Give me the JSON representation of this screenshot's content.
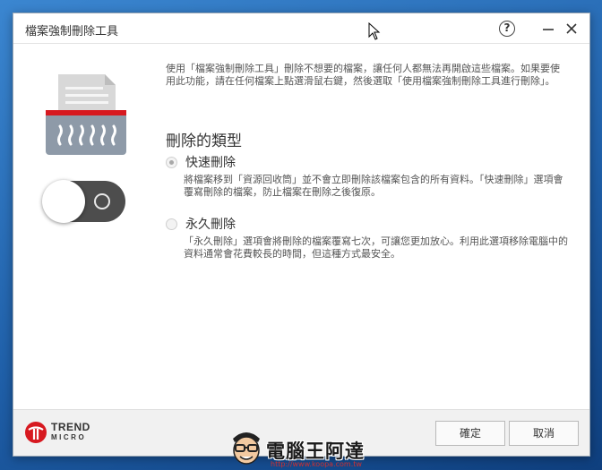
{
  "window": {
    "title": "檔案強制刪除工具",
    "help_glyph": "?",
    "minimize_glyph": "—",
    "close_glyph": "✕"
  },
  "content": {
    "intro": "使用「檔案強制刪除工具」刪除不想要的檔案，讓任何人都無法再開啟這些檔案。如果要使用此功能，請在任何檔案上點選滑鼠右鍵，然後選取「使用檔案強制刪除工具進行刪除」。",
    "section_title": "刪除的類型",
    "options": [
      {
        "label": "快速刪除",
        "checked": true,
        "description": "將檔案移到「資源回收筒」並不會立即刪除該檔案包含的所有資料。「快速刪除」選項會覆寫刪除的檔案，防止檔案在刪除之後復原。"
      },
      {
        "label": "永久刪除",
        "checked": false,
        "description": "「永久刪除」選項會將刪除的檔案覆寫七次，可讓您更加放心。利用此選項移除電腦中的資料通常會花費較長的時間，但這種方式最安全。"
      }
    ],
    "toggle_on": false
  },
  "footer": {
    "brand_top": "TREND",
    "brand_bottom": "MICRO",
    "ok_label": "確定",
    "cancel_label": "取消"
  },
  "watermark": {
    "text": "電腦王阿達",
    "url": "http://www.koopa.com.tw"
  },
  "colors": {
    "accent_red": "#d71920",
    "toggle_track": "#4d4d4d",
    "window_bg": "#ffffff",
    "footer_bg": "#f1f1f1"
  },
  "icons": {
    "shredder": "document-shredder-icon",
    "help": "help-icon",
    "minimize": "minimize-icon",
    "close": "close-icon",
    "cursor": "mouse-cursor-icon",
    "brand": "trend-micro-logo-icon"
  }
}
